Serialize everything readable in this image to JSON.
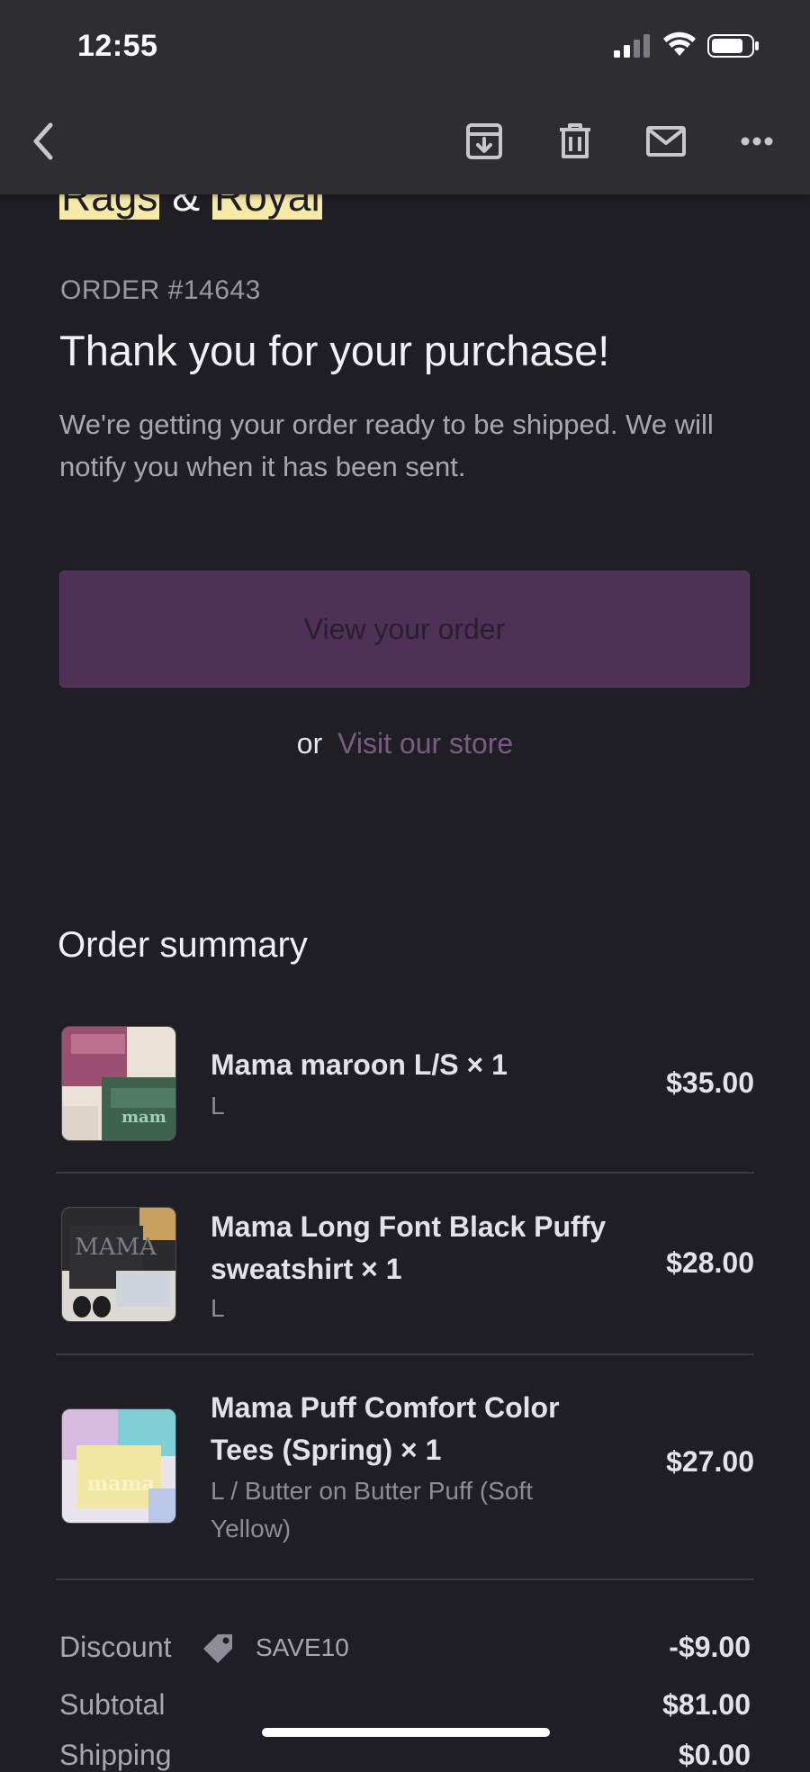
{
  "status_bar": {
    "time": "12:55"
  },
  "brand": {
    "part1": "Rags",
    "amp": "&",
    "part2": "Royal"
  },
  "order": {
    "number": "ORDER #14643",
    "title": "Thank you for your purchase!",
    "message": "We're getting your order ready to be shipped. We will notify you when it has been sent.",
    "view_button": "View your order",
    "or_text": "or",
    "store_link": "Visit our store"
  },
  "summary": {
    "title": "Order summary",
    "items": [
      {
        "name": "Mama maroon L/S × 1",
        "variant": "L",
        "price": "$35.00"
      },
      {
        "name": "Mama Long Font Black Puffy sweatshirt × 1",
        "variant": "L",
        "price": "$28.00"
      },
      {
        "name": "Mama Puff Comfort Color Tees (Spring) × 1",
        "variant": "L / Butter on Butter Puff (Soft Yellow)",
        "price": "$27.00"
      }
    ],
    "thumb_text": {
      "item1": "mam",
      "item2": "MAMA",
      "item3": "mama"
    },
    "discount": {
      "label": "Discount",
      "code": "SAVE10",
      "value": "-$9.00"
    },
    "subtotal": {
      "label": "Subtotal",
      "value": "$81.00"
    },
    "shipping": {
      "label": "Shipping",
      "value": "$0.00"
    }
  },
  "colors": {
    "background": "#1f1e24",
    "toolbar": "#2e2d32",
    "button": "#4f3057",
    "link": "#7a5c83",
    "highlight": "#f7e9a8"
  },
  "icons": [
    "back-chevron-icon",
    "archive-icon",
    "trash-icon",
    "mail-icon",
    "more-icon",
    "tag-icon"
  ]
}
